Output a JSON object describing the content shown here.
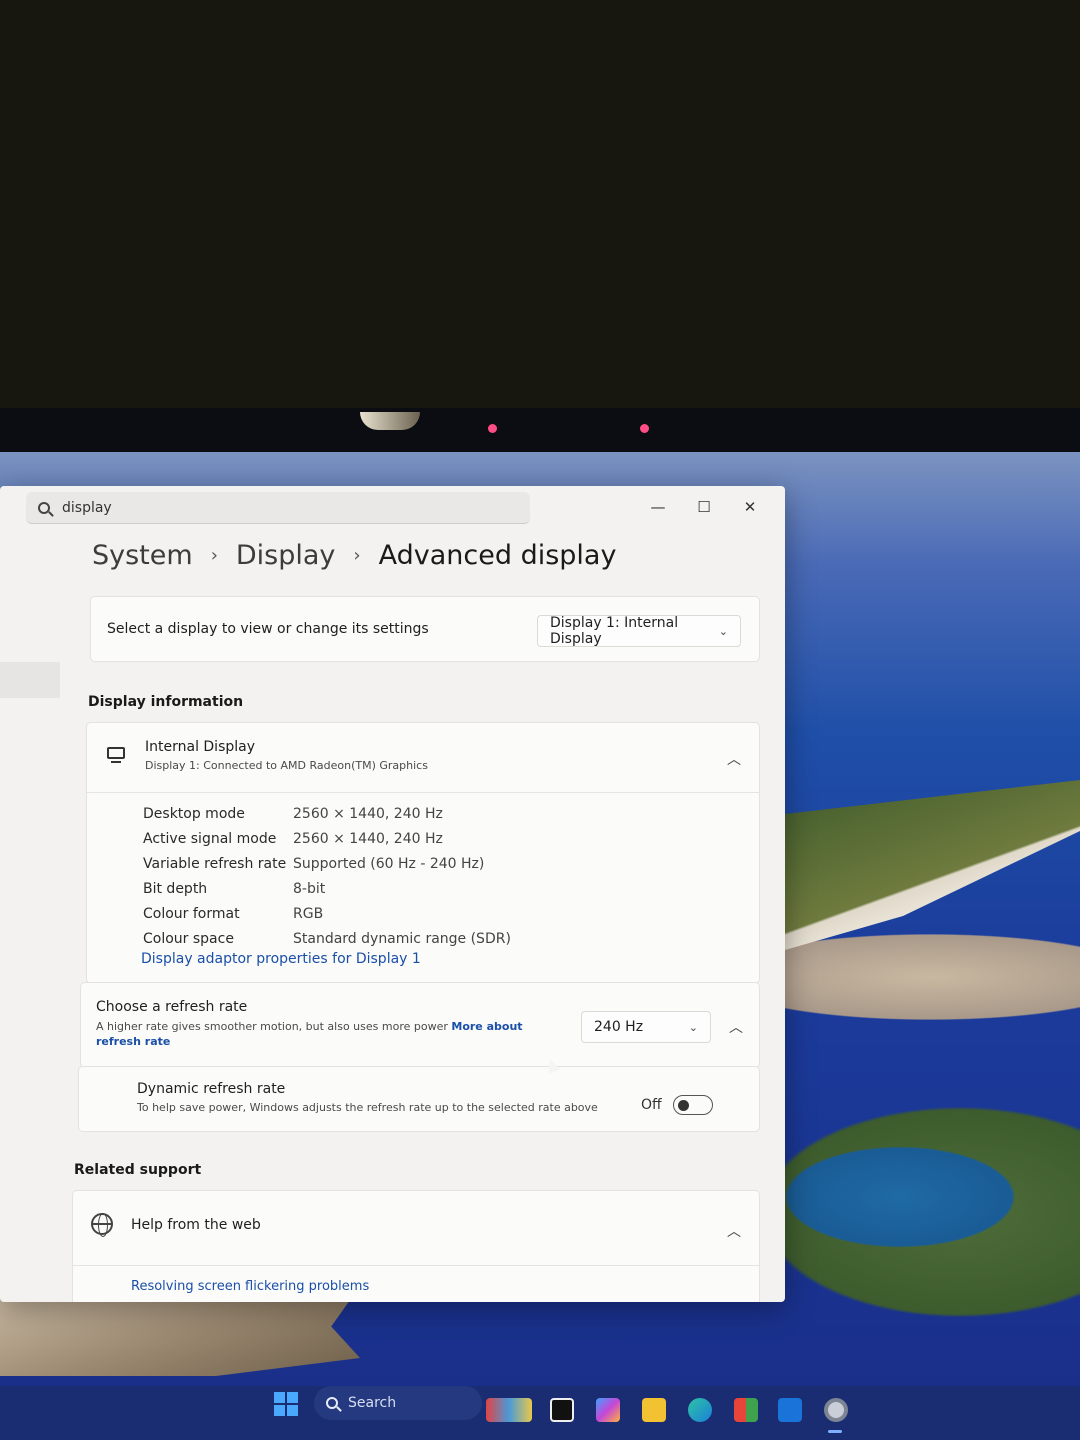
{
  "window": {
    "search_value": "display",
    "controls": {
      "minimize": "—",
      "maximize": "☐",
      "close": "✕"
    }
  },
  "breadcrumb": {
    "level1": "System",
    "level2": "Display",
    "level3": "Advanced display",
    "separator": "›"
  },
  "select_display": {
    "label": "Select a display to view or change its settings",
    "dropdown_value": "Display 1: Internal Display"
  },
  "display_information": {
    "section_title": "Display information",
    "name": "Internal Display",
    "subtitle": "Display 1: Connected to AMD Radeon(TM) Graphics",
    "rows": [
      {
        "key": "Desktop mode",
        "value": "2560 × 1440, 240 Hz"
      },
      {
        "key": "Active signal mode",
        "value": "2560 × 1440, 240 Hz"
      },
      {
        "key": "Variable refresh rate",
        "value": "Supported (60 Hz - 240 Hz)"
      },
      {
        "key": "Bit depth",
        "value": "8-bit"
      },
      {
        "key": "Colour format",
        "value": "RGB"
      },
      {
        "key": "Colour space",
        "value": "Standard dynamic range (SDR)"
      }
    ],
    "adaptor_link": "Display adaptor properties for Display 1"
  },
  "refresh_rate": {
    "title": "Choose a refresh rate",
    "description": "A higher rate gives smoother motion, but also uses more power",
    "link": "More about refresh rate",
    "dropdown_value": "240 Hz"
  },
  "dynamic_refresh": {
    "title": "Dynamic refresh rate",
    "description": "To help save power, Windows adjusts the refresh rate up to the selected rate above",
    "toggle_label": "Off",
    "toggle_on": false
  },
  "related_support": {
    "section_title": "Related support",
    "help_title": "Help from the web",
    "help_link": "Resolving screen flickering problems"
  },
  "taskbar": {
    "search_label": "Search",
    "icons": [
      "start-icon",
      "search-icon",
      "widgets-icon",
      "task-view-icon",
      "m365-icon",
      "file-explorer-icon",
      "edge-icon",
      "store-icon",
      "outlook-icon",
      "settings-icon"
    ]
  },
  "colors": {
    "accent_link": "#1a4fa8",
    "taskbar": "#1a2d72",
    "window_bg": "#f3f2f1"
  }
}
